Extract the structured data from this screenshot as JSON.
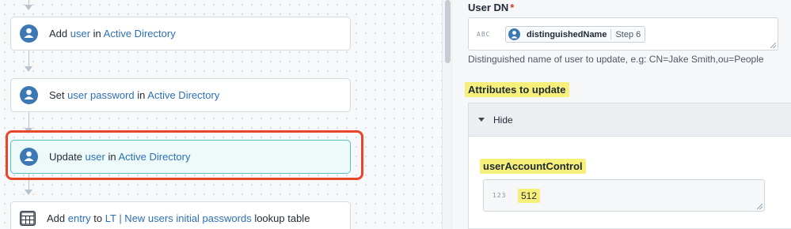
{
  "workflow": {
    "steps": [
      {
        "parts": [
          {
            "t": "Add ",
            "kw": false
          },
          {
            "t": "user",
            "kw": true
          },
          {
            "t": " in ",
            "kw": false
          },
          {
            "t": "Active Directory",
            "kw": true
          }
        ],
        "icon": "ldap-icon"
      },
      {
        "parts": [
          {
            "t": "Set ",
            "kw": false
          },
          {
            "t": "user password",
            "kw": true
          },
          {
            "t": " in ",
            "kw": false
          },
          {
            "t": "Active Directory",
            "kw": true
          }
        ],
        "icon": "ldap-icon"
      },
      {
        "parts": [
          {
            "t": "Update ",
            "kw": false
          },
          {
            "t": "user",
            "kw": true
          },
          {
            "t": " in ",
            "kw": false
          },
          {
            "t": "Active Directory",
            "kw": true
          }
        ],
        "icon": "ldap-icon",
        "active": true
      },
      {
        "parts": [
          {
            "t": "Add ",
            "kw": false
          },
          {
            "t": "entry",
            "kw": true
          },
          {
            "t": " to ",
            "kw": false
          },
          {
            "t": "LT | New users initial passwords",
            "kw": true
          },
          {
            "t": " lookup table",
            "kw": false
          }
        ],
        "icon": "table-icon"
      }
    ],
    "icon_label": "LDAP"
  },
  "panel": {
    "user_dn": {
      "label": "User DN",
      "required_mark": "*",
      "type_tag": "ABC",
      "chip_name": "distinguishedName",
      "chip_step": "Step 6",
      "helper": "Distinguished name of user to update, e.g: CN=Jake Smith,ou=People"
    },
    "attributes": {
      "label": "Attributes to update",
      "toggle_label": "Hide",
      "field_label": "userAccountControl",
      "type_tag": "123",
      "value": "512"
    }
  },
  "colors": {
    "highlight_frame": "#e8452a",
    "marker": "#f6f07a",
    "active_border": "#5bbcc1",
    "link": "#2d6fb7"
  }
}
